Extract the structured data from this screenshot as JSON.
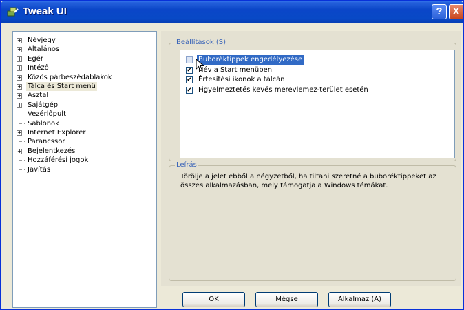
{
  "window": {
    "title": "Tweak UI",
    "help_label": "?",
    "close_label": "X",
    "accent_color": "#0a46c8"
  },
  "tree": {
    "items": [
      {
        "label": "Névjegy",
        "expandable": true
      },
      {
        "label": "Általános",
        "expandable": true
      },
      {
        "label": "Egér",
        "expandable": true
      },
      {
        "label": "Intéző",
        "expandable": true
      },
      {
        "label": "Közös párbeszédablakok",
        "expandable": true
      },
      {
        "label": "Tálca és Start menü",
        "expandable": true,
        "selected": true
      },
      {
        "label": "Asztal",
        "expandable": true
      },
      {
        "label": "Sajátgép",
        "expandable": true
      },
      {
        "label": "Vezérlőpult",
        "expandable": false
      },
      {
        "label": "Sablonok",
        "expandable": false
      },
      {
        "label": "Internet Explorer",
        "expandable": true
      },
      {
        "label": "Parancssor",
        "expandable": false
      },
      {
        "label": "Bejelentkezés",
        "expandable": true
      },
      {
        "label": "Hozzáférési jogok",
        "expandable": false
      },
      {
        "label": "Javítás",
        "expandable": false
      }
    ],
    "expander_glyph": "+"
  },
  "settings": {
    "group_title": "Beállítások (S)",
    "items": [
      {
        "label": "Buboréktippek engedélyezése",
        "checked": false,
        "selected": true
      },
      {
        "label": "Név a Start menüben",
        "checked": true
      },
      {
        "label": "Értesítési ikonok a tálcán",
        "checked": true
      },
      {
        "label": "Figyelmeztetés kevés merevlemez-terület esetén",
        "checked": true
      }
    ],
    "check_glyph": "✔"
  },
  "description": {
    "group_title": "Leírás",
    "text": "Törölje a jelet ebből a négyzetből, ha tiltani szeretné a buboréktippeket az összes alkalmazásban, mely támogatja a Windows témákat."
  },
  "buttons": {
    "ok": "OK",
    "cancel": "Mégse",
    "apply": "Alkalmaz (A)"
  }
}
